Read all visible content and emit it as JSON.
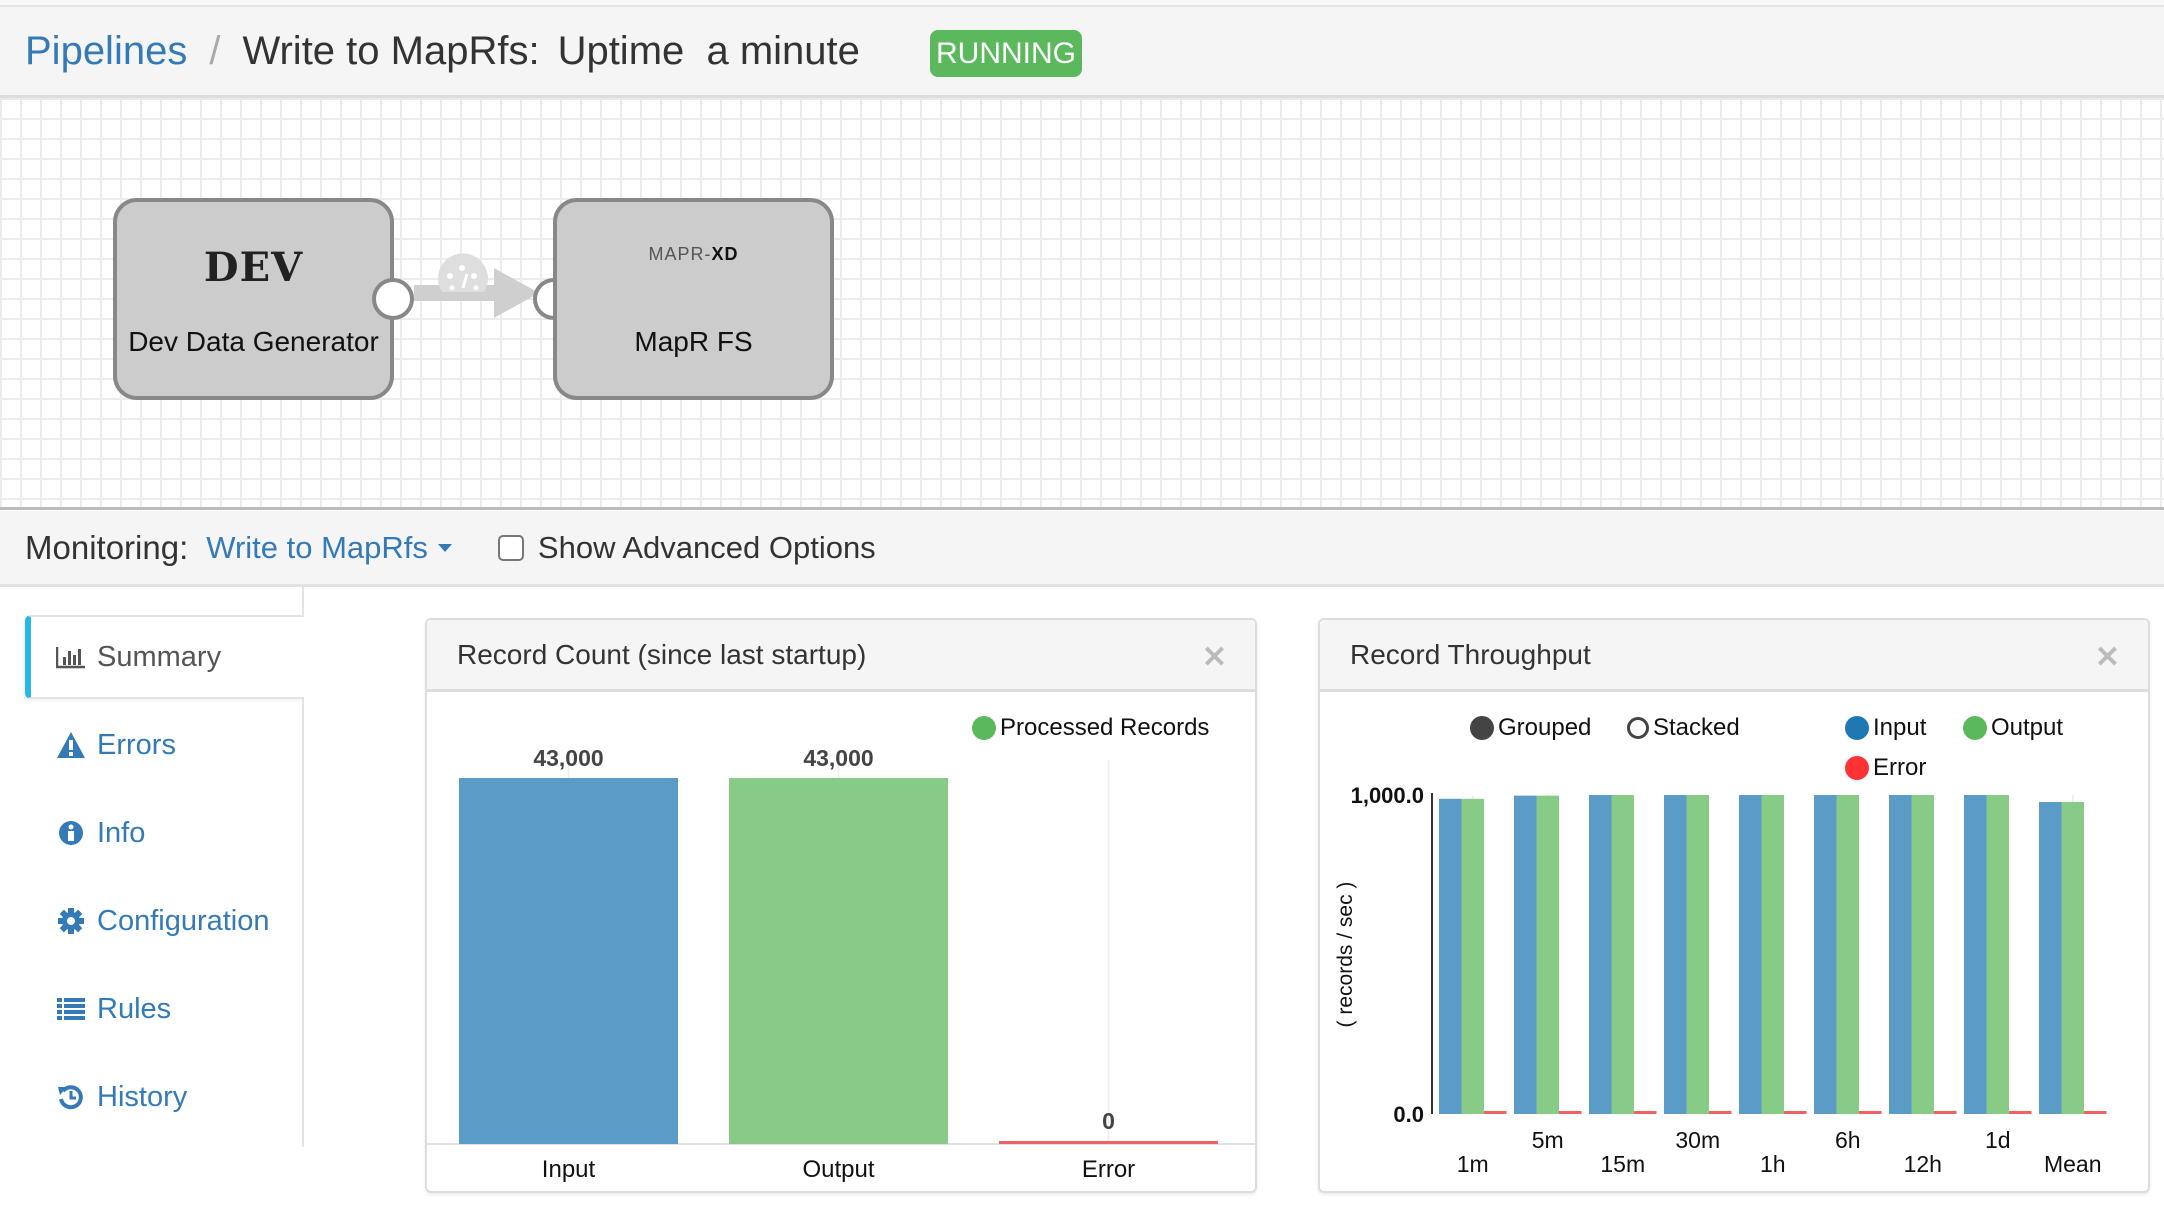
{
  "header": {
    "breadcrumb_root": "Pipelines",
    "separator": "/",
    "pipeline_title": "Write to MapRfs:",
    "uptime_label": "Uptime  a minute",
    "status": "RUNNING",
    "status_color": "#5cb85c"
  },
  "canvas": {
    "nodes": [
      {
        "icon_text": "DEV",
        "label": "Dev Data Generator"
      },
      {
        "icon_text_light": "MAPR-",
        "icon_text_bold": "XD",
        "label": "MapR FS"
      }
    ],
    "link_icon": "gauge-icon"
  },
  "monitoring": {
    "label": "Monitoring:",
    "selected": "Write to MapRfs",
    "advanced_checkbox_label": "Show Advanced Options",
    "advanced_checked": false
  },
  "sidebar": {
    "items": [
      {
        "label": "Summary",
        "icon": "bar-chart-icon",
        "active": true
      },
      {
        "label": "Errors",
        "icon": "warning-icon",
        "active": false
      },
      {
        "label": "Info",
        "icon": "info-icon",
        "active": false
      },
      {
        "label": "Configuration",
        "icon": "gear-icon",
        "active": false
      },
      {
        "label": "Rules",
        "icon": "list-icon",
        "active": false
      },
      {
        "label": "History",
        "icon": "history-icon",
        "active": false
      }
    ]
  },
  "colors": {
    "input": "#5b9bc8",
    "output": "#87cb87",
    "error": "#f06262",
    "link": "#337ab7",
    "active_tab_accent": "#29b6e8"
  },
  "chart_data": [
    {
      "type": "bar",
      "title": "Record Count (since last startup)",
      "legend": [
        {
          "label": "Processed Records",
          "color": "#5cb85c"
        }
      ],
      "legend_position": "top-right",
      "categories": [
        "Input",
        "Output",
        "Error"
      ],
      "values": [
        43000,
        43000,
        0
      ],
      "value_labels": [
        "43,000",
        "43,000",
        "0"
      ],
      "bar_colors": [
        "#5b9bc8",
        "#87cb87",
        "#f06262"
      ],
      "ylim": [
        0,
        43000
      ],
      "xlabel": "",
      "ylabel": ""
    },
    {
      "type": "bar",
      "title": "Record Throughput",
      "mode_options": [
        {
          "label": "Grouped",
          "selected": true
        },
        {
          "label": "Stacked",
          "selected": false
        }
      ],
      "legend": [
        {
          "label": "Input",
          "color": "#1f77b4"
        },
        {
          "label": "Output",
          "color": "#5cb85c"
        },
        {
          "label": "Error",
          "color": "#ff3333"
        }
      ],
      "legend_position": "top-right",
      "categories": [
        "1m",
        "5m",
        "15m",
        "30m",
        "1h",
        "6h",
        "12h",
        "1d",
        "Mean"
      ],
      "series": [
        {
          "name": "Input",
          "values": [
            988,
            998,
            1000,
            1000,
            1000,
            1000,
            1000,
            1000,
            978
          ]
        },
        {
          "name": "Output",
          "values": [
            988,
            998,
            1000,
            1000,
            1000,
            1000,
            1000,
            1000,
            978
          ]
        },
        {
          "name": "Error",
          "values": [
            0,
            0,
            0,
            0,
            0,
            0,
            0,
            0,
            0
          ]
        }
      ],
      "y_ticks": [
        "0.0",
        "1,000.0"
      ],
      "ylim": [
        0,
        1000
      ],
      "xlabel": "",
      "ylabel": "( records / sec )"
    }
  ]
}
